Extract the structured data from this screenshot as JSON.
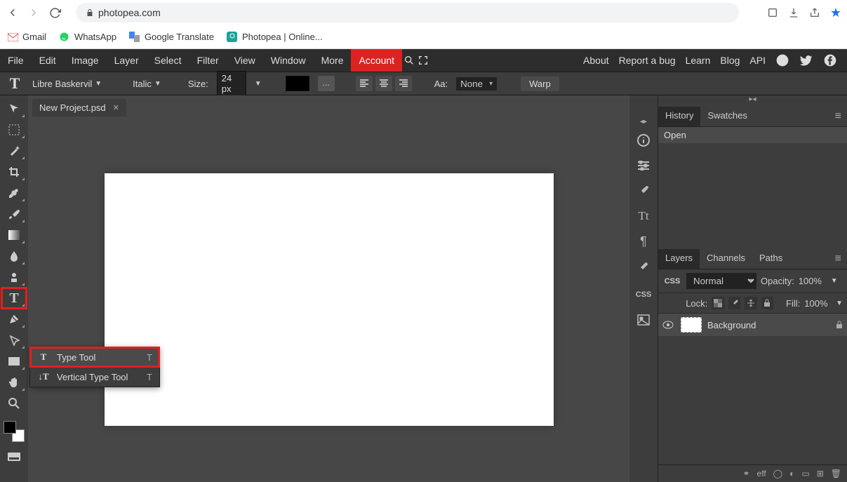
{
  "browser": {
    "url": "photopea.com"
  },
  "bookmarks": [
    {
      "label": "Gmail",
      "icon": "M"
    },
    {
      "label": "WhatsApp"
    },
    {
      "label": "Google Translate"
    },
    {
      "label": "Photopea | Online..."
    }
  ],
  "menu": [
    "File",
    "Edit",
    "Image",
    "Layer",
    "Select",
    "Filter",
    "View",
    "Window",
    "More"
  ],
  "menu_account": "Account",
  "menu_right": [
    "About",
    "Report a bug",
    "Learn",
    "Blog",
    "API"
  ],
  "options": {
    "font": "Libre Baskervil",
    "style": "Italic",
    "size_label": "Size:",
    "size_value": "24 px",
    "aa_label": "Aa:",
    "aa_value": "None",
    "warp": "Warp"
  },
  "doc_tab": "New Project.psd",
  "flyout": [
    {
      "label": "Type Tool",
      "key": "T",
      "selected": true
    },
    {
      "label": "Vertical Type Tool",
      "key": "T",
      "selected": false
    }
  ],
  "panels": {
    "history_tabs": [
      "History",
      "Swatches"
    ],
    "history_item": "Open",
    "layers_tabs": [
      "Layers",
      "Channels",
      "Paths"
    ],
    "blend_mode": "Normal",
    "opacity_label": "Opacity:",
    "opacity_value": "100%",
    "lock_label": "Lock:",
    "fill_label": "Fill:",
    "fill_value": "100%",
    "layer_name": "Background",
    "footer_eff": "eff"
  }
}
